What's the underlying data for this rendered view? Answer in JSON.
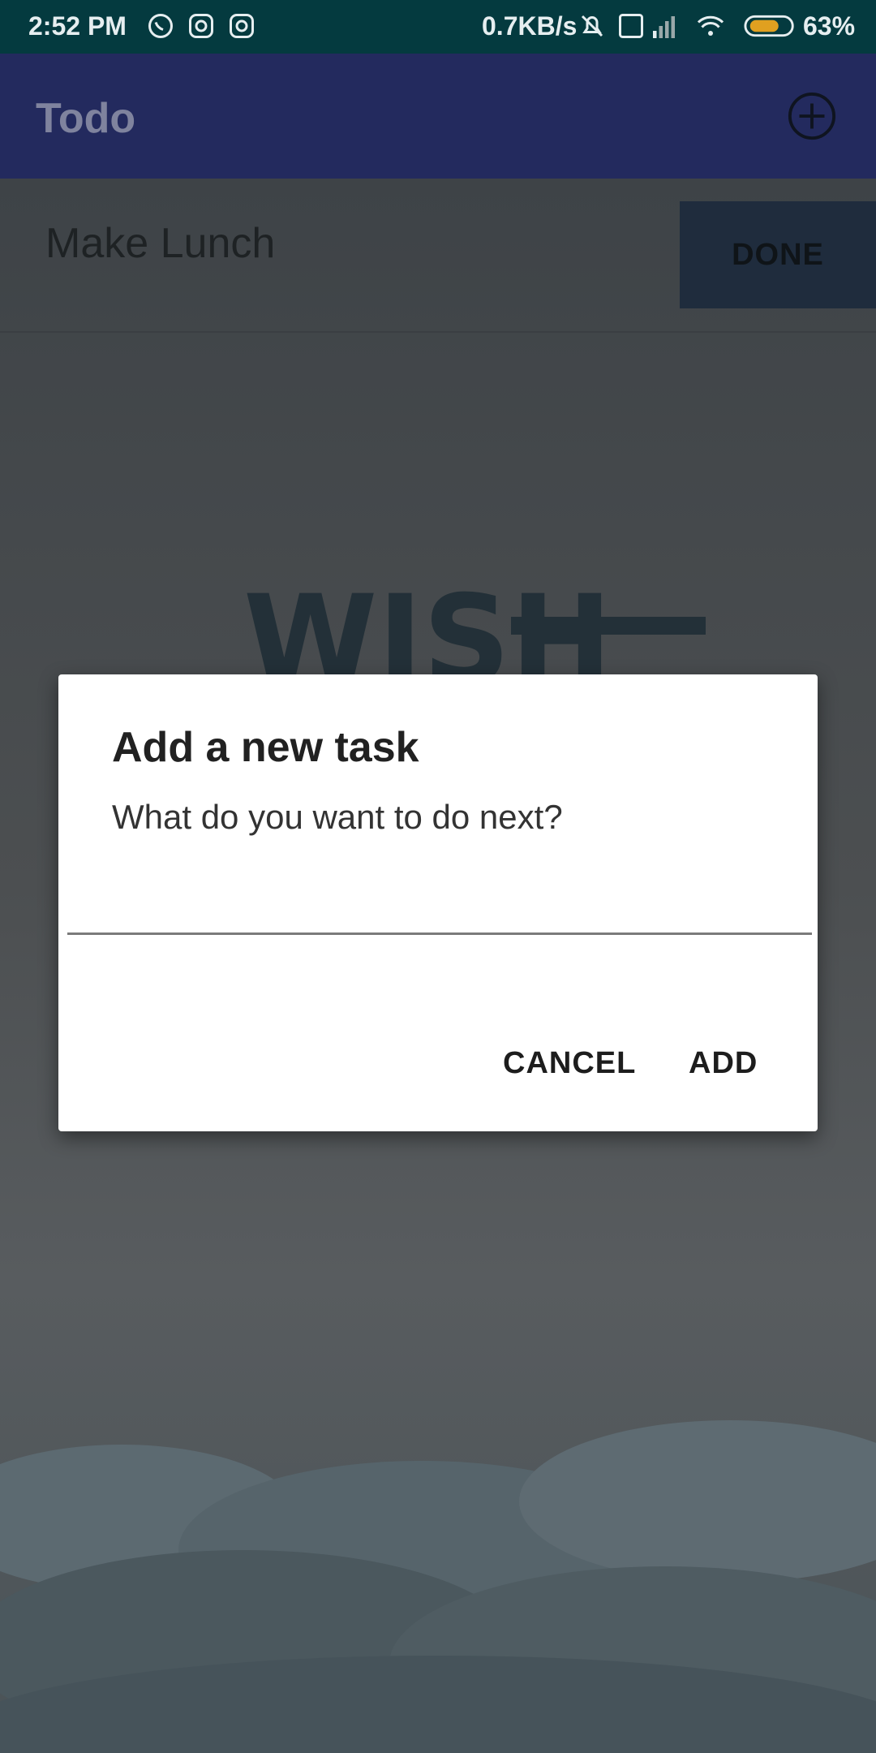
{
  "status_bar": {
    "time": "2:52 PM",
    "net_speed": "0.7KB/s",
    "battery_percent": "63%",
    "icons": [
      "whatsapp-icon",
      "instagram-icon",
      "instagram-icon",
      "mute-icon",
      "volte-icon",
      "signal-icon",
      "wifi-icon",
      "battery-icon"
    ]
  },
  "app_bar": {
    "title": "Todo",
    "add_icon": "add-circle-icon"
  },
  "task_list": [
    {
      "label": "Make Lunch",
      "action": "DONE"
    }
  ],
  "background_art": {
    "text": "WISH"
  },
  "dialog": {
    "title": "Add a new task",
    "message": "What do you want to do next?",
    "input_value": "",
    "cancel_label": "CANCEL",
    "add_label": "ADD"
  },
  "colors": {
    "status_bar": "#043a3f",
    "app_bar": "#232a5e",
    "done_button": "#1f2c3d",
    "dialog_bg": "#ffffff"
  }
}
